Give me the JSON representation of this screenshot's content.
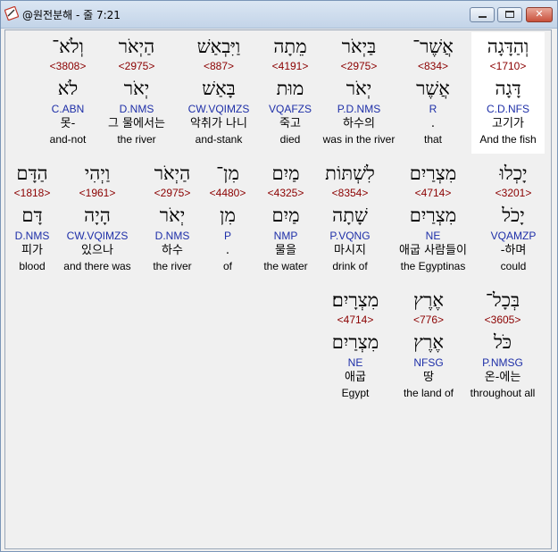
{
  "window": {
    "title": "@원전분해 - 줄 7:21"
  },
  "rows": [
    [
      {
        "hebrew": "וְהַדָּגָה",
        "strong": "<1710>",
        "root": "דָּגָה",
        "parse": "C.D.NFS",
        "korean": "고기가",
        "english": "And the fish",
        "highlight": true
      },
      {
        "hebrew": "אֲשֶׁר־",
        "strong": "<834>",
        "root": "אֲשֶׁר",
        "parse": "R",
        "korean": ".",
        "english": "that"
      },
      {
        "hebrew": "בַּיְאֹר",
        "strong": "<2975>",
        "root": "יְאֹר",
        "parse": "P.D.NMS",
        "korean": "하수의",
        "english": "was in the river"
      },
      {
        "hebrew": "מֵתָה",
        "strong": "<4191>",
        "root": "מוּת",
        "parse": "VQAFZS",
        "korean": "죽고",
        "english": "died"
      },
      {
        "hebrew": "וַיִּבְאַשׁ",
        "strong": "<887>",
        "root": "בָּאַשׁ",
        "parse": "CW.VQIMZS",
        "korean": "악취가 나니",
        "english": "and-stank"
      },
      {
        "hebrew": "הַיְאֹר",
        "strong": "<2975>",
        "root": "יְאֹר",
        "parse": "D.NMS",
        "korean": "그 물에서는",
        "english": "the river"
      },
      {
        "hebrew": "וְלֹא־",
        "strong": "<3808>",
        "root": "לֹא",
        "parse": "C.ABN",
        "korean": "못-",
        "english": "and-not"
      }
    ],
    [
      {
        "hebrew": "יָכְלוּ",
        "strong": "<3201>",
        "root": "יָכֹל",
        "parse": "VQAMZP",
        "korean": "-하며",
        "english": "could"
      },
      {
        "hebrew": "מִצְרַיִם",
        "strong": "<4714>",
        "root": "מִצְרַיִם",
        "parse": "NE",
        "korean": "애굽 사람들이",
        "english": "the Egyptinas"
      },
      {
        "hebrew": "לִשְׁתּוֹת",
        "strong": "<8354>",
        "root": "שָׁתָה",
        "parse": "P.VQNG",
        "korean": "마시지",
        "english": "drink of"
      },
      {
        "hebrew": "מַיִם",
        "strong": "<4325>",
        "root": "מַיִם",
        "parse": "NMP",
        "korean": "물을",
        "english": "the water"
      },
      {
        "hebrew": "מִן־",
        "strong": "<4480>",
        "root": "מִן",
        "parse": "P",
        "korean": ".",
        "english": "of"
      },
      {
        "hebrew": "הַיְאֹר",
        "strong": "<2975>",
        "root": "יְאֹר",
        "parse": "D.NMS",
        "korean": "하수",
        "english": "the river"
      },
      {
        "hebrew": "וַיְהִי",
        "strong": "<1961>",
        "root": "הָיָה",
        "parse": "CW.VQIMZS",
        "korean": "있으나",
        "english": "and there was"
      },
      {
        "hebrew": "הַדָּם",
        "strong": "<1818>",
        "root": "דָּם",
        "parse": "D.NMS",
        "korean": "피가",
        "english": "blood"
      }
    ],
    [
      {
        "hebrew": "בְּכָל־",
        "strong": "<3605>",
        "root": "כֹּל",
        "parse": "P.NMSG",
        "korean": "온-에는",
        "english": "throughout all"
      },
      {
        "hebrew": "אֶרֶץ",
        "strong": "<776>",
        "root": "אֶרֶץ",
        "parse": "NFSG",
        "korean": "땅",
        "english": "the land of"
      },
      {
        "hebrew": "מִצְרָיִם׃",
        "strong": "<4714>",
        "root": "מִצְרַיִם",
        "parse": "NE",
        "korean": "애굽",
        "english": "Egypt"
      }
    ]
  ]
}
